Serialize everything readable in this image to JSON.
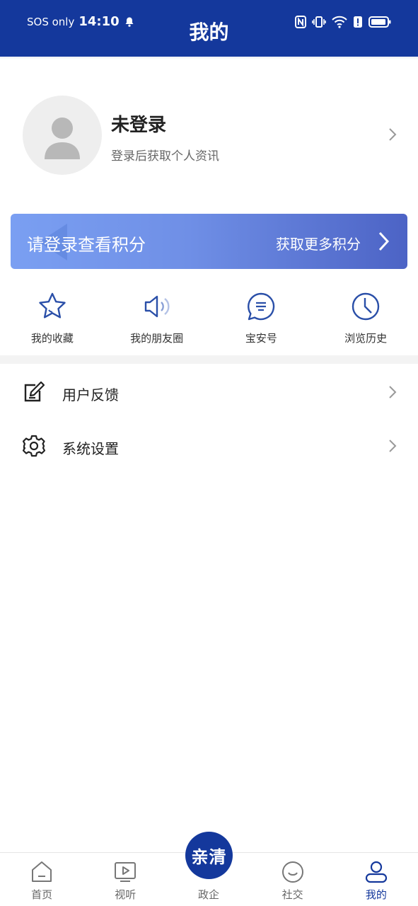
{
  "status": {
    "carrier": "SOS only",
    "time": "14:10"
  },
  "header": {
    "title": "我的"
  },
  "profile": {
    "name": "未登录",
    "subtitle": "登录后获取个人资讯"
  },
  "points": {
    "left_text": "请登录查看积分",
    "right_text": "获取更多积分"
  },
  "actions": [
    {
      "label": "我的收藏",
      "icon": "star-icon"
    },
    {
      "label": "我的朋友圈",
      "icon": "speaker-icon"
    },
    {
      "label": "宝安号",
      "icon": "chat-icon"
    },
    {
      "label": "浏览历史",
      "icon": "clock-icon"
    }
  ],
  "menu": [
    {
      "label": "用户反馈",
      "icon": "edit-icon"
    },
    {
      "label": "系统设置",
      "icon": "gear-icon"
    }
  ],
  "bottom_nav": {
    "items": [
      {
        "label": "首页",
        "icon": "home-icon"
      },
      {
        "label": "视听",
        "icon": "play-icon"
      },
      {
        "label": "政企",
        "icon": "badge-icon"
      },
      {
        "label": "社交",
        "icon": "smile-icon"
      },
      {
        "label": "我的",
        "icon": "user-icon"
      }
    ],
    "center_badge": "亲清",
    "active_index": 4
  },
  "colors": {
    "primary": "#14389c",
    "banner_start": "#7a9ff2",
    "banner_end": "#4c63c5"
  }
}
